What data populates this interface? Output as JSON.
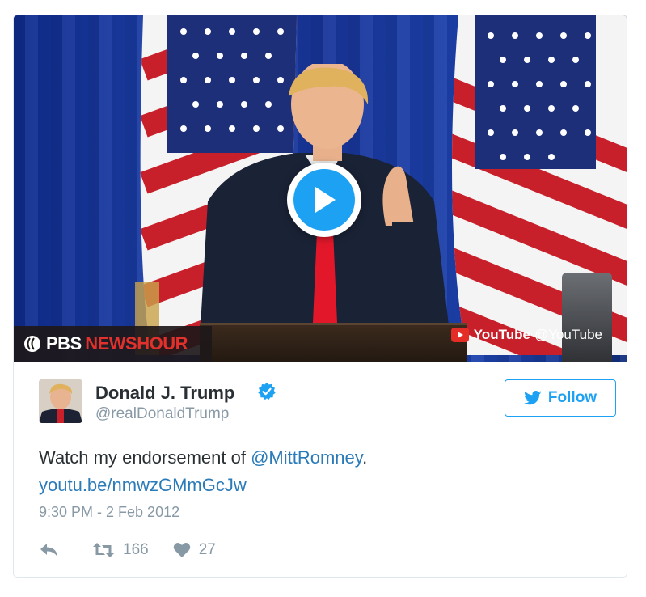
{
  "media": {
    "pbs_prefix": "PBS",
    "pbs_suffix": "NEWSHOUR",
    "youtube_brand": "YouTube",
    "youtube_handle": "@YouTube",
    "play_icon": "play-icon"
  },
  "author": {
    "name": "Donald J. Trump",
    "handle": "@realDonaldTrump",
    "verified_icon": "verified-badge-icon"
  },
  "follow": {
    "label": "Follow",
    "icon": "twitter-bird-icon"
  },
  "tweet": {
    "text_before": "Watch my endorsement of ",
    "mention": "@MittRomney",
    "text_after": ".",
    "link": "youtu.be/nmwzGMmGcJw",
    "timestamp": "9:30 PM - 2 Feb 2012"
  },
  "actions": {
    "reply_icon": "reply-icon",
    "retweet_icon": "retweet-icon",
    "retweet_count": "166",
    "like_icon": "heart-icon",
    "like_count": "27"
  },
  "colors": {
    "accent": "#1da1f2",
    "link": "#2b7bb9",
    "muted": "#8899a6",
    "pbs_red": "#e0312c"
  }
}
